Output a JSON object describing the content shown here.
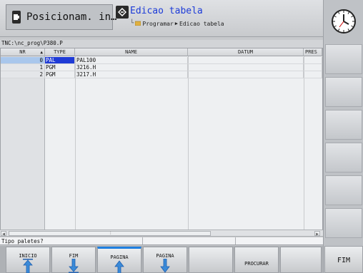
{
  "header": {
    "exec_mode_label": "Posicionam. in…",
    "prog_mode_title": "Edicao tabela",
    "breadcrumb": [
      "Programar",
      "Edicao tabela"
    ]
  },
  "file_path": "TNC:\\nc_prog\\P380.P",
  "table": {
    "columns": [
      "NR",
      "TYPE",
      "NAME",
      "DATUM",
      "PRES"
    ],
    "rows": [
      {
        "nr": "0",
        "type": "PAL",
        "name": "PAL100",
        "datum": "",
        "pres": ""
      },
      {
        "nr": "1",
        "type": "PGM",
        "name": "3216.H",
        "datum": "",
        "pres": ""
      },
      {
        "nr": "2",
        "type": "PGM",
        "name": "3217.H",
        "datum": "",
        "pres": ""
      }
    ],
    "selected_row": 0
  },
  "status": {
    "prompt": "Tipo paletes?"
  },
  "softkeys": [
    {
      "label": "INICIO",
      "icon": "arrow-up-icon"
    },
    {
      "label": "FIM",
      "icon": "arrow-down-icon"
    },
    {
      "label": "PAGINA",
      "icon": "arrow-up-icon"
    },
    {
      "label": "PAGINA",
      "icon": "arrow-down-icon"
    },
    {
      "label": "",
      "icon": ""
    },
    {
      "label": "PROCURAR",
      "icon": ""
    },
    {
      "label": "",
      "icon": ""
    }
  ],
  "fim_key_label": "FIM",
  "colors": {
    "accent_blue": "#1f3bd6",
    "title_blue": "#1c3bd8",
    "active_softkey": "#1f7fe0"
  }
}
